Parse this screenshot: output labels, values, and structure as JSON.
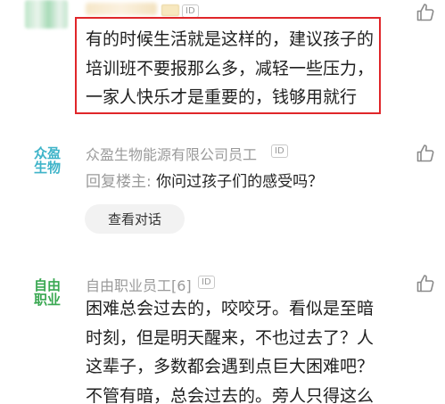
{
  "comments": [
    {
      "avatar_text": "",
      "username": "",
      "id_badge": "ID",
      "body_lines": [
        "有的时候生活就是这样的，建议孩子的",
        "培训班不要报那么多，减轻一些压力，",
        "一家人快乐才是重要的，钱够用就行"
      ]
    },
    {
      "avatar_text_line1": "众盈",
      "avatar_text_line2": "生物",
      "username": "众盈生物能源有限公司员工",
      "id_badge": "ID",
      "reply_prefix": "回复楼主:",
      "reply_text": " 你问过孩子们的感受吗？",
      "view_dialog_label": "查看对话"
    },
    {
      "avatar_text_line1": "自由",
      "avatar_text_line2": "职业",
      "username": "自由职业员工[6]",
      "id_badge": "ID",
      "body_lines": [
        "困难总会过去的，咬咬牙。看似是至暗",
        "时刻，但是明天醒来，不也过去了？人",
        "这辈子，多数都会遇到点巨大困难吧？",
        "不管有暗，总会过去的。旁人只得这么"
      ]
    }
  ],
  "icons": {
    "like": "thumbs-up-icon"
  },
  "colors": {
    "highlight_border": "#e0262a",
    "meta_gray": "#9a9a9a",
    "avatar_cyan": "#3fb4c9",
    "avatar_green": "#3aa852"
  }
}
